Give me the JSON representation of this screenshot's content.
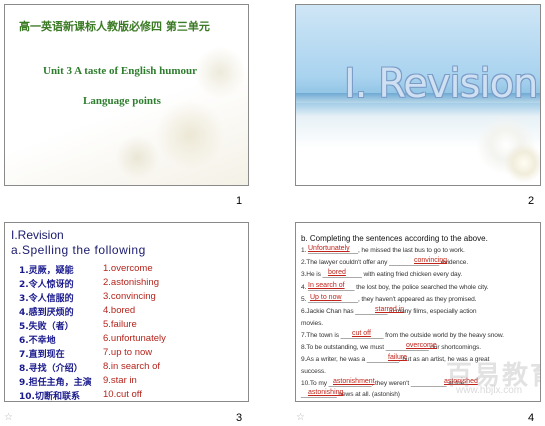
{
  "slides": {
    "s1": {
      "title_cn": "高一英语新课标人教版必修四 第三单元",
      "unit": "Unit 3   A taste of English humour",
      "language_points": "Language points",
      "page": "1"
    },
    "s2": {
      "heading": "I. Revision",
      "page": "2"
    },
    "s3": {
      "heading1": "I.Revision",
      "heading2": "a.Spelling the following",
      "items": [
        {
          "cn": "1.灵厥，疑能",
          "en": "1.overcome"
        },
        {
          "cn": "2.令人惊讶的",
          "en": "2.astonishing"
        },
        {
          "cn": "3.令人信服的",
          "en": "3.convincing"
        },
        {
          "cn": "4.感到厌烦的",
          "en": "4.bored"
        },
        {
          "cn": "5.失败（者）",
          "en": "5.failure"
        },
        {
          "cn": "6.不幸地",
          "en": "6.unfortunately"
        },
        {
          "cn": "7.直到现在",
          "en": "7.up to now"
        },
        {
          "cn": "8.寻找（介绍）",
          "en": "8.in search of"
        },
        {
          "cn": "9.担任主角，主演",
          "en": "9.star in"
        },
        {
          "cn": "10.切断和联系",
          "en": "10.cut off"
        }
      ],
      "page": "3"
    },
    "s4": {
      "title": "b.  Completing the sentences according to the above.",
      "lines": [
        "1. ______________, he missed the last bus to go to work.",
        "2.The lawyer couldn't offer any ______________ evidence.",
        "3.He is ___________ with eating fried chicken every day.",
        "4. _____________ the lost boy, the police searched the whole city.",
        "5. ______________, they haven't appeared as they promised.",
        "6.Jackie Chan has _________ in many films, especially action",
        "movies.",
        "7.The town is ____________ from the outside world by the heavy snow.",
        "8.To be outstanding, we must ____________ our shortcomings.",
        "9.As a writer, he was a _________, but as an artist, he was a great",
        "success.",
        "10.To my ____________, they weren't __________ at the",
        "__________ news at all.   (astonish)"
      ],
      "answers": [
        "Unfortunately",
        "convincing",
        "bored",
        "In search of",
        "Up to now",
        "starred in",
        "cut off",
        "overcome",
        "failure",
        "astonishment",
        "astonished",
        "astonishing"
      ],
      "watermark_cn": "百易教育网",
      "watermark_url": "www.hbjlx.com",
      "page": "4"
    }
  },
  "colors": {
    "title_green": "#3b7a24",
    "list_blue": "#1a1a8e",
    "answer_red": "#c0241a"
  }
}
